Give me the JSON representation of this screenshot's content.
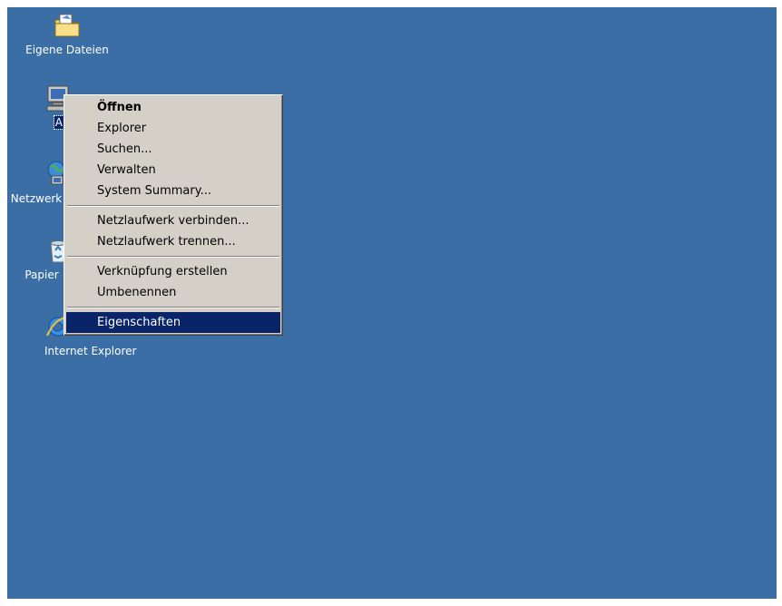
{
  "desktop": {
    "background_color": "#3a6ea5",
    "icons": [
      {
        "label": "Eigene Dateien",
        "icon": "folder-documents-icon"
      },
      {
        "label": "Arbeits",
        "icon": "my-computer-icon",
        "selected": true
      },
      {
        "label": "Netzwerk",
        "icon": "network-places-icon"
      },
      {
        "label": "Papier",
        "icon": "recycle-bin-icon"
      },
      {
        "label": "Internet Explorer",
        "icon": "internet-explorer-icon"
      }
    ]
  },
  "context_menu": {
    "items": [
      {
        "label": "Öffnen",
        "bold": true
      },
      {
        "label": "Explorer"
      },
      {
        "label": "Suchen..."
      },
      {
        "label": "Verwalten"
      },
      {
        "label": "System Summary..."
      },
      {
        "label": "Netzlaufwerk verbinden..."
      },
      {
        "label": "Netzlaufwerk trennen..."
      },
      {
        "label": "Verknüpfung erstellen"
      },
      {
        "label": "Umbenennen"
      },
      {
        "label": "Eigenschaften",
        "highlighted": true
      }
    ],
    "highlight_color": "#0a246a"
  }
}
